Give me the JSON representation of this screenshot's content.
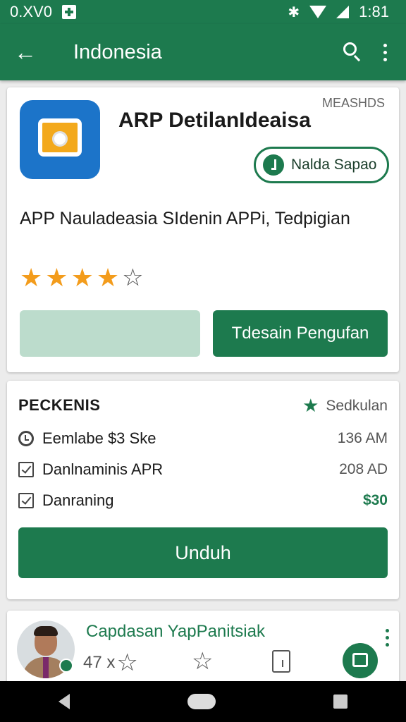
{
  "status_bar": {
    "time_left": "0.XV0",
    "time_right": "1:81"
  },
  "app_bar": {
    "title": "Indonesia"
  },
  "app_card": {
    "name": "ARP DetilanIdeaisa",
    "tag": "MEASHDS",
    "pill_label": "Nalda Sapao",
    "description": "APP Nauladeasia SIdenin APPi, Tedpigian",
    "rating": {
      "filled": 4,
      "total": 5
    },
    "primary_button": "Tdesain Pengufan",
    "colors": {
      "accent": "#1d7a4e",
      "star": "#f39c1c",
      "icon_bg": "#1c74c9"
    }
  },
  "details_card": {
    "title": "PECKENIS",
    "right_label": "Sedkulan",
    "rows": [
      {
        "icon": "clock-icon",
        "label": "Eemlabe $3 Ske",
        "value": "136 AM"
      },
      {
        "icon": "checkbox-icon",
        "label": "Danlnaminis APR",
        "value": "208 AD"
      },
      {
        "icon": "checkbox-icon",
        "label": "Danraning",
        "value": "$30"
      }
    ],
    "download_button": "Unduh"
  },
  "developer_card": {
    "name": "Capdasan YapPanitsiak",
    "count": "47 x"
  }
}
